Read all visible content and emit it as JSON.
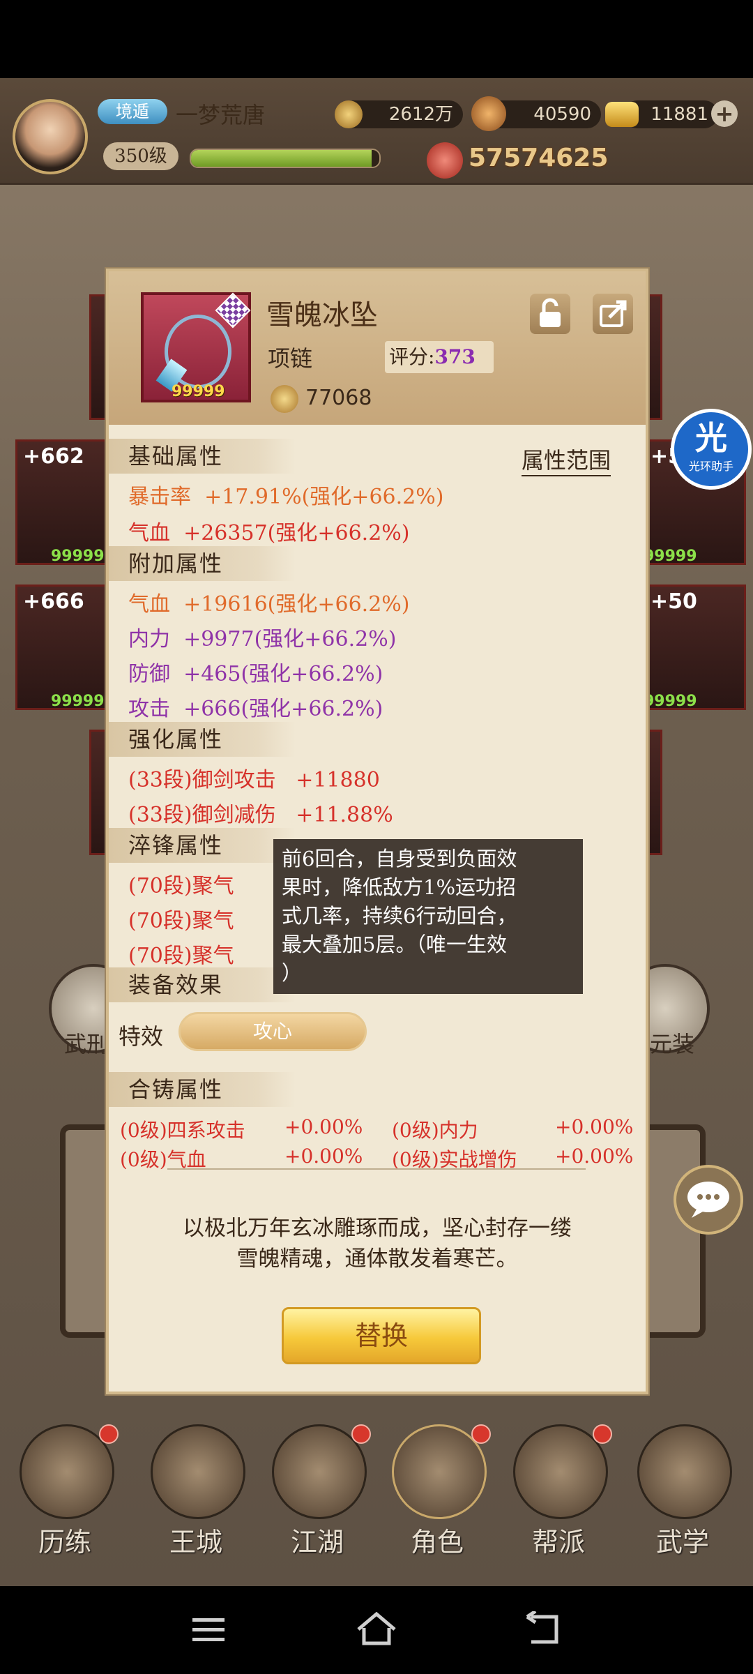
{
  "header": {
    "title_badge": "境遁",
    "player_name": "一梦荒唐",
    "level": "350级",
    "xp_percent": 96,
    "currencies": [
      {
        "icon": "copper-coin-icon",
        "value": "2612万"
      },
      {
        "icon": "spirit-jar-icon",
        "value": "40590"
      },
      {
        "icon": "gold-ingot-icon",
        "value": "11881"
      }
    ],
    "combat_power": "57574625"
  },
  "background_slots": {
    "left_top": "+662",
    "left_mid": "+666",
    "right_top": "+52",
    "right_mid": "+50",
    "count": "99999",
    "left_round_label": "武刑",
    "right_round_label": "元装"
  },
  "dialog": {
    "item_name": "雪魄冰坠",
    "item_type": "项链",
    "score_label": "评分:",
    "score_value": "373",
    "stack_count": "99999",
    "price": "77068",
    "range_link": "属性范围",
    "sections": {
      "basic": {
        "title": "基础属性",
        "rows": [
          {
            "label": "暴击率",
            "value": "+17.91%(强化+66.2%)"
          },
          {
            "label": "气血",
            "value": "+26357(强化+66.2%)"
          }
        ]
      },
      "extra": {
        "title": "附加属性",
        "rows": [
          {
            "label": "气血",
            "value": "+19616(强化+66.2%)"
          },
          {
            "label": "内力",
            "value": "+9977(强化+66.2%)"
          },
          {
            "label": "防御",
            "value": "+465(强化+66.2%)"
          },
          {
            "label": "攻击",
            "value": "+666(强化+66.2%)"
          }
        ]
      },
      "enhance": {
        "title": "强化属性",
        "rows": [
          {
            "label": "(33段)御剑攻击",
            "value": "+11880"
          },
          {
            "label": "(33段)御剑减伤",
            "value": "+11.88%"
          }
        ]
      },
      "temper": {
        "title": "淬锋属性",
        "rows": [
          {
            "label": "(70段)聚气"
          },
          {
            "label": "(70段)聚气"
          },
          {
            "label": "(70段)聚气"
          }
        ]
      },
      "effect": {
        "title": "装备效果",
        "special_label": "特效",
        "special_button": "攻心"
      },
      "alloy": {
        "title": "合铸属性",
        "rows": [
          {
            "label": "(0级)四系攻击",
            "value": "+0.00%"
          },
          {
            "label": "(0级)内力",
            "value": "+0.00%"
          },
          {
            "label": "(0级)气血",
            "value": "+0.00%"
          },
          {
            "label": "(0级)实战增伤",
            "value": "+0.00%"
          }
        ]
      }
    },
    "tooltip_lines": [
      "前6回合，自身受到负面效",
      "果时，降低敌方1%运功招",
      "式几率，持续6行动回合，",
      "最大叠加5层。（唯一生效",
      "）"
    ],
    "description_lines": [
      "以极北万年玄冰雕琢而成，坚心封存一缕",
      "雪魄精魂，通体散发着寒芒。"
    ],
    "replace_button": "替换"
  },
  "floating": {
    "helper_char": "光",
    "helper_label": "光环助手"
  },
  "bottom_nav": [
    {
      "label": "历练"
    },
    {
      "label": "王城"
    },
    {
      "label": "江湖"
    },
    {
      "label": "角色"
    },
    {
      "label": "帮派"
    },
    {
      "label": "武学"
    }
  ],
  "colors": {
    "attr_orange": "#e06a2a",
    "attr_red": "#d6312a",
    "score_purple": "#8f33a8",
    "dialog_bg": "#f1e8d4"
  }
}
